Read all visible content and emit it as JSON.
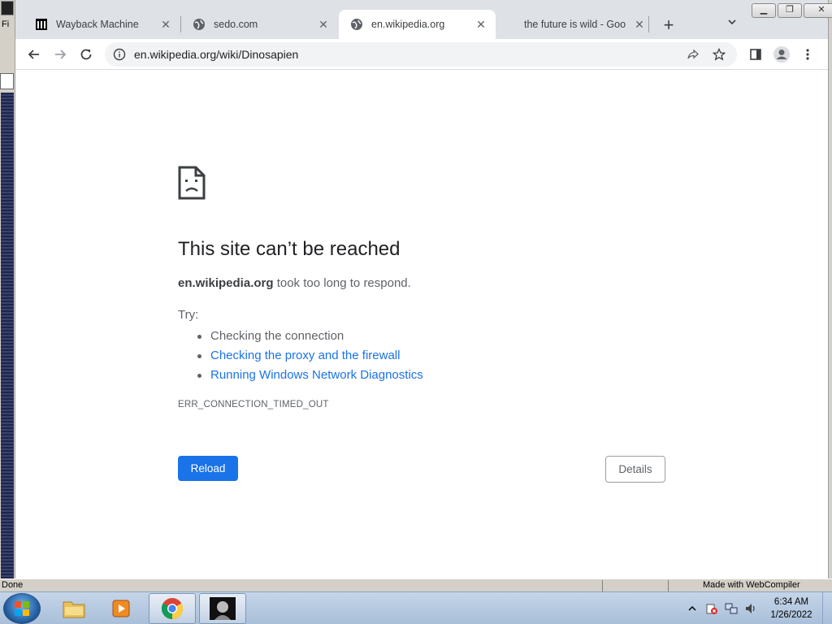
{
  "legacy_window": {
    "menu_stub": "Fi",
    "status_text": "Done",
    "credit": "Made with WebCompiler"
  },
  "browser": {
    "tabs": [
      {
        "title": "Wayback Machine",
        "icon": "columns-icon",
        "active": false
      },
      {
        "title": "sedo.com",
        "icon": "globe-icon",
        "active": false
      },
      {
        "title": "en.wikipedia.org",
        "icon": "globe-icon",
        "active": true
      },
      {
        "title": "the future is wild - Goo",
        "icon": "none",
        "active": false
      }
    ],
    "new_tab_label": "+",
    "url": "en.wikipedia.org/wiki/Dinosapien"
  },
  "error_page": {
    "icon": "sad-document-icon",
    "title": "This site can’t be reached",
    "host": "en.wikipedia.org",
    "summary_rest": " took too long to respond.",
    "try_label": "Try:",
    "suggestions": [
      {
        "text": "Checking the connection",
        "link": false
      },
      {
        "text": "Checking the proxy and the firewall",
        "link": true
      },
      {
        "text": "Running Windows Network Diagnostics",
        "link": true
      }
    ],
    "error_code": "ERR_CONNECTION_TIMED_OUT",
    "reload_label": "Reload",
    "details_label": "Details"
  },
  "taskbar": {
    "items": [
      "explorer",
      "media-player",
      "chrome",
      "webcompiler-app"
    ],
    "clock_time": "6:34 AM",
    "clock_date": "1/26/2022"
  },
  "colors": {
    "link": "#1a73e8",
    "primary_button": "#1a73e8",
    "tabstrip": "#dee1e6"
  }
}
